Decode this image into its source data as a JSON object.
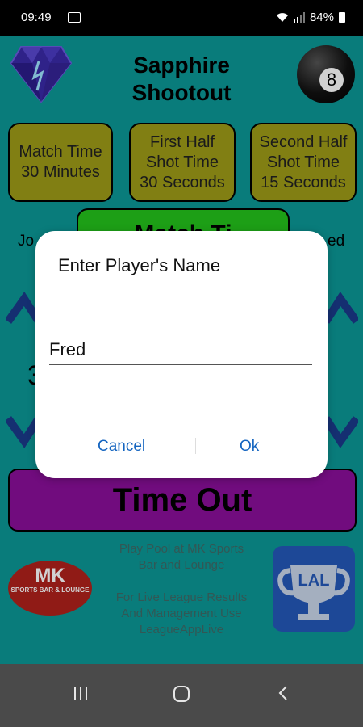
{
  "status_bar": {
    "time": "09:49",
    "battery": "84%"
  },
  "app": {
    "title_line1": "Sapphire",
    "title_line2": "Shootout",
    "boxes": [
      {
        "line1": "Match Time",
        "line2": "30 Minutes",
        "line3": ""
      },
      {
        "line1": "First Half",
        "line2": "Shot Time",
        "line3": "30 Seconds"
      },
      {
        "line1": "Second Half",
        "line2": "Shot Time",
        "line3": "15 Seconds"
      }
    ],
    "green_button": "Match Ti",
    "left_partial": "Jo",
    "right_partial": "ed",
    "left_number": "3",
    "timeout_label": "Time Out",
    "info_line1": "Play Pool at MK Sports",
    "info_line2": "Bar and Lounge",
    "info_line3": "For Live League Results",
    "info_line4": "And Management Use",
    "info_line5": "LeagueAppLive",
    "mk_logo_text": "MK",
    "mk_logo_sub": "SPORTS BAR & LOUNGE",
    "lal_logo_text": "LAL",
    "eight_ball_number": "8",
    "colors": {
      "background": "#0c9896",
      "box": "#9e9b18",
      "green": "#24c31c",
      "purple": "#8a0f9a",
      "accent": "#1565c0"
    }
  },
  "dialog": {
    "title": "Enter Player's Name",
    "input_value": "Fred",
    "cancel_label": "Cancel",
    "ok_label": "Ok"
  },
  "nav": {
    "recents_icon": "recents-icon",
    "home_icon": "home-icon",
    "back_icon": "back-icon"
  }
}
